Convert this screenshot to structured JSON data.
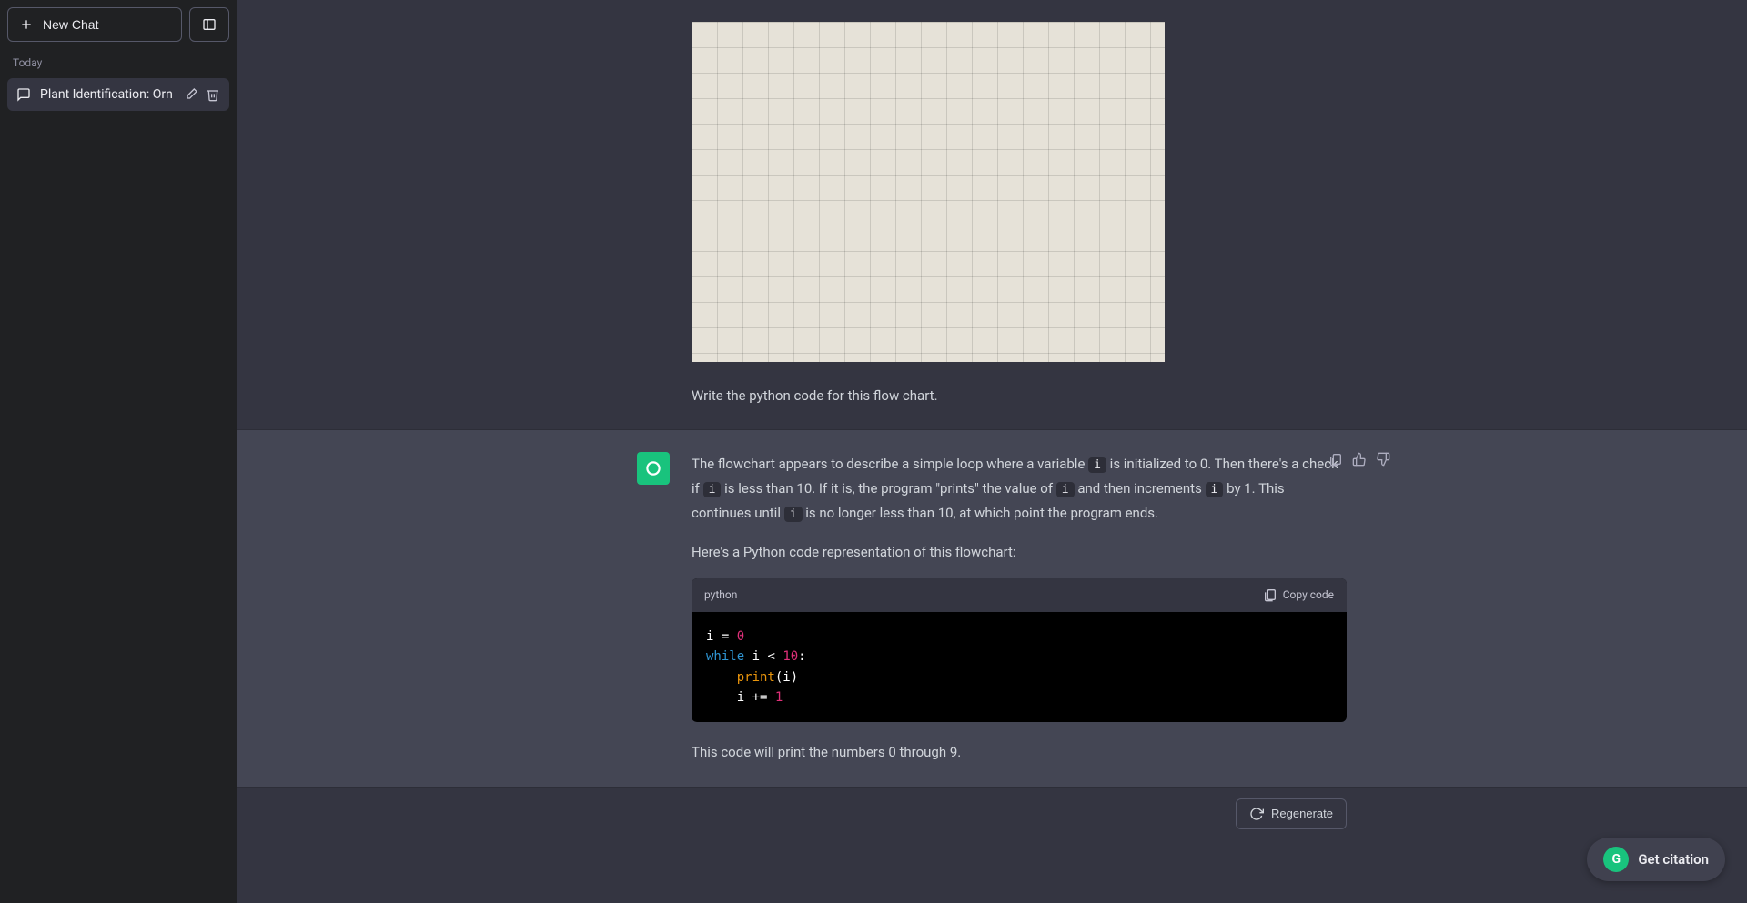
{
  "sidebar": {
    "new_chat_label": "New Chat",
    "section_label": "Today",
    "chat_title": "Plant Identification: Orn"
  },
  "user_msg": {
    "prompt": "Write the python code for this flow chart."
  },
  "assistant_msg": {
    "p1_a": "The flowchart appears to describe a simple loop where a variable ",
    "c1": "i",
    "p1_b": " is initialized to 0. Then there's a check if ",
    "c2": "i",
    "p1_c": " is less than 10. If it is, the program \"prints\" the value of ",
    "c3": "i",
    "p1_d": " and then increments ",
    "c4": "i",
    "p1_e": " by 1. This continues until ",
    "c5": "i",
    "p1_f": " is no longer less than 10, at which point the program ends.",
    "p2": "Here's a Python code representation of this flowchart:",
    "p3": "This code will print the numbers 0 through 9."
  },
  "code": {
    "lang": "python",
    "copy_label": "Copy code",
    "l1_a": "i = ",
    "l1_num": "0",
    "l2_kw": "while",
    "l2_b": " i < ",
    "l2_num": "10",
    "l2_c": ":",
    "l3_pad": "    ",
    "l3_fn": "print",
    "l3_b": "(i)",
    "l4_pad": "    i += ",
    "l4_num": "1"
  },
  "bottom": {
    "regenerate_label": "Regenerate"
  },
  "floating": {
    "badge": "G",
    "label": "Get citation"
  }
}
